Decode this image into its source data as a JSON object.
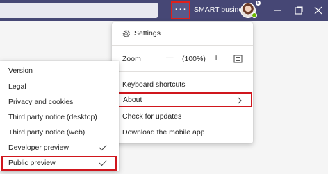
{
  "header": {
    "more_label": "···",
    "tenant_name": "SMART business",
    "avatar_badge": "8"
  },
  "settings_menu": {
    "settings_label": "Settings",
    "zoom_label": "Zoom",
    "zoom_value": "(100%)",
    "zoom_out_symbol": "—",
    "zoom_in_symbol": "+",
    "keyboard_shortcuts_label": "Keyboard shortcuts",
    "about_label": "About",
    "check_updates_label": "Check for updates",
    "download_app_label": "Download the mobile app"
  },
  "about_submenu": {
    "items": [
      {
        "label": "Version",
        "checked": false
      },
      {
        "label": "Legal",
        "checked": false
      },
      {
        "label": "Privacy and cookies",
        "checked": false
      },
      {
        "label": "Third party notice (desktop)",
        "checked": false
      },
      {
        "label": "Third party notice (web)",
        "checked": false
      },
      {
        "label": "Developer preview",
        "checked": true
      },
      {
        "label": "Public preview",
        "checked": true
      }
    ]
  },
  "colors": {
    "titlebar": "#464775",
    "highlight_border": "#d0161d",
    "presence": "#6bb700"
  },
  "icons": [
    "more-icon",
    "minimize-icon",
    "maximize-icon",
    "close-icon",
    "gear-icon",
    "zoom-fit-icon",
    "chevron-right-icon",
    "checkmark-icon"
  ]
}
